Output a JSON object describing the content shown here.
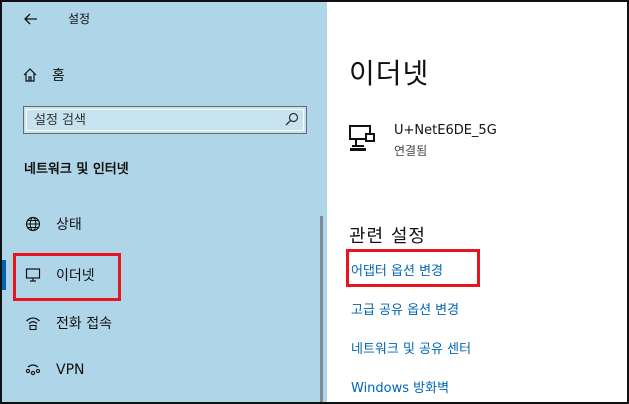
{
  "window": {
    "title": "설정",
    "back_icon": "back-arrow-icon"
  },
  "sidebar": {
    "home_label": "홈",
    "search": {
      "placeholder": "설정 검색",
      "icon": "search-icon"
    },
    "section_title": "네트워크 및 인터넷",
    "items": [
      {
        "label": "상태",
        "icon": "globe-icon",
        "active": false
      },
      {
        "label": "이더넷",
        "icon": "monitor-icon",
        "active": true
      },
      {
        "label": "전화 접속",
        "icon": "dialup-icon",
        "active": false
      },
      {
        "label": "VPN",
        "icon": "vpn-icon",
        "active": false
      }
    ]
  },
  "main": {
    "page_title": "이더넷",
    "network": {
      "name": "U+NetE6DE_5G",
      "status": "연결됨",
      "icon": "ethernet-icon"
    },
    "related_title": "관련 설정",
    "links": [
      {
        "label": "어댑터 옵션 변경"
      },
      {
        "label": "고급 공유 옵션 변경"
      },
      {
        "label": "네트워크 및 공유 센터"
      },
      {
        "label": "Windows 방화벽"
      }
    ]
  },
  "colors": {
    "sidebar_bg": "#afd6e8",
    "link": "#0066b4",
    "highlight_box": "#e8141e",
    "active_indicator": "#0063b1"
  }
}
